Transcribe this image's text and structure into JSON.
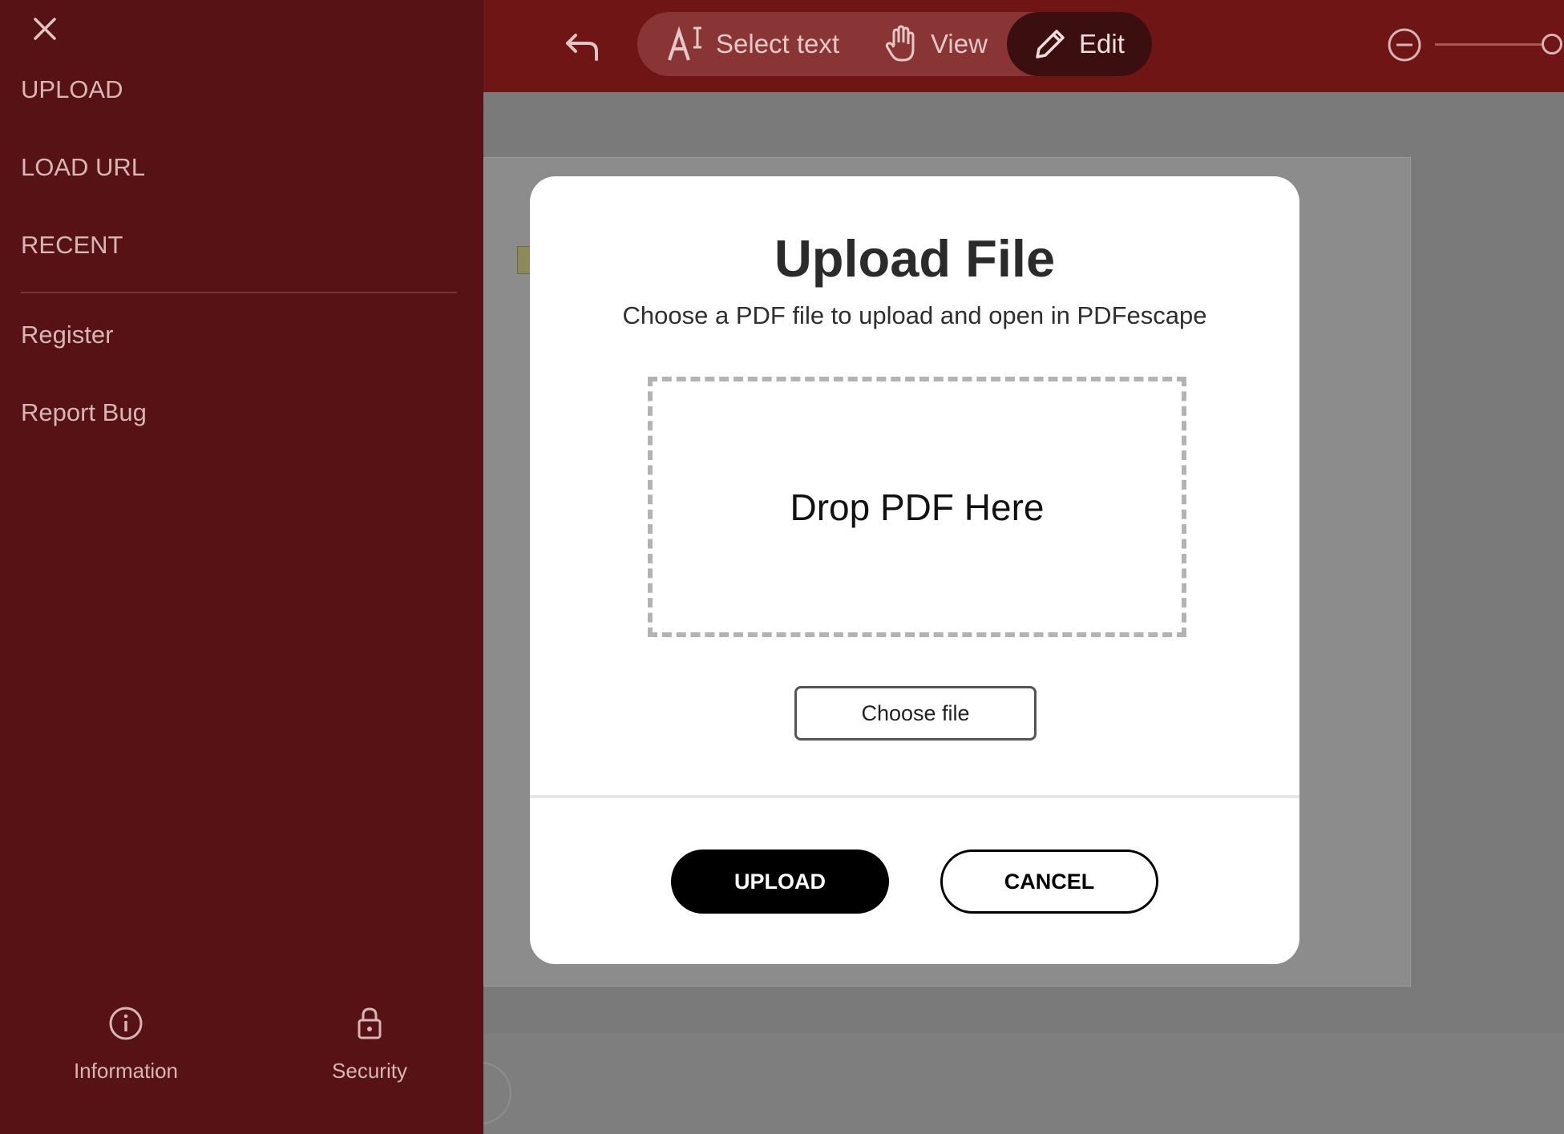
{
  "toolbar": {
    "undo_icon": "undo-arrow-icon",
    "modes": [
      {
        "label": "Select text",
        "icon": "select-text-icon"
      },
      {
        "label": "View",
        "icon": "hand-icon"
      },
      {
        "label": "Edit",
        "icon": "pencil-icon",
        "active": true
      }
    ],
    "zoom_out_icon": "zoom-out-icon"
  },
  "sidebar": {
    "close_icon": "close-icon",
    "items": [
      {
        "label": "UPLOAD"
      },
      {
        "label": "LOAD URL"
      },
      {
        "label": "RECENT"
      },
      {
        "label": "Register"
      },
      {
        "label": "Report Bug"
      }
    ],
    "footer": [
      {
        "label": "Information",
        "icon": "info-icon"
      },
      {
        "label": "Security",
        "icon": "lock-icon"
      }
    ]
  },
  "modal": {
    "title": "Upload File",
    "subtitle": "Choose a PDF file to upload and open in PDFescape",
    "dropzone_text": "Drop PDF Here",
    "choose_file_label": "Choose file",
    "upload_label": "UPLOAD",
    "cancel_label": "CANCEL"
  },
  "colors": {
    "toolbar_bg": "#6f1515",
    "sidebar_bg": "#561214",
    "primary_button": "#000000",
    "modal_bg": "#ffffff"
  }
}
